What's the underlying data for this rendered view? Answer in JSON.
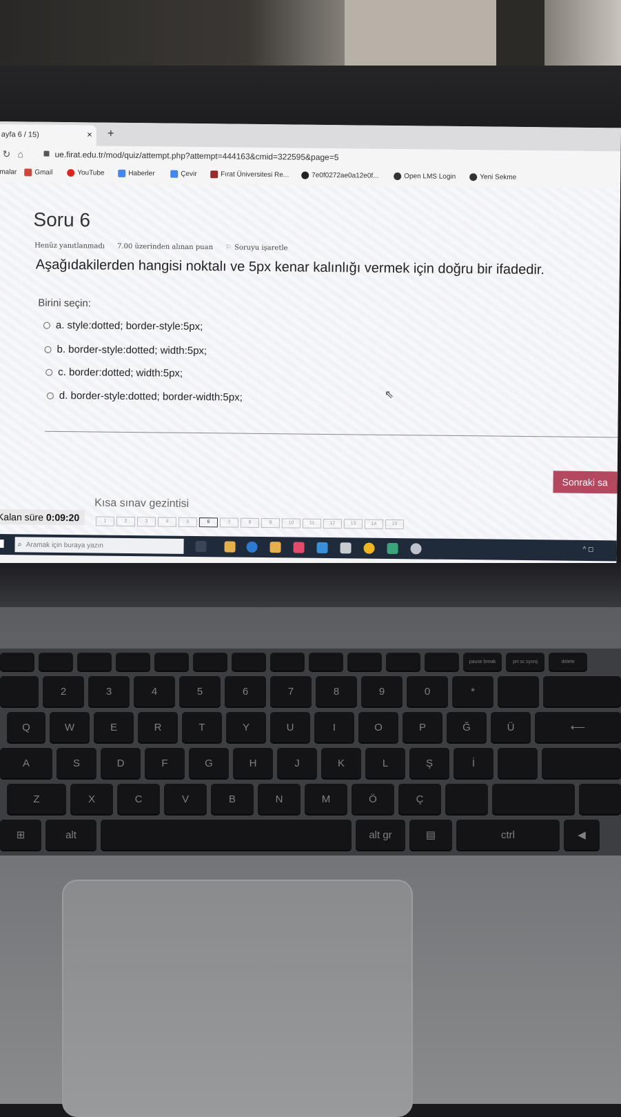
{
  "browser": {
    "tab_title": "ayfa 6 / 15)",
    "tab_close": "×",
    "new_tab": "+",
    "url": "ue.firat.edu.tr/mod/quiz/attempt.php?attempt=444163&cmid=322595&page=5",
    "bookmarks": [
      {
        "label": "malar",
        "icon_color": ""
      },
      {
        "label": "Gmail",
        "icon_color": "#d44638"
      },
      {
        "label": "YouTube",
        "icon_color": "#e62117"
      },
      {
        "label": "Haberler",
        "icon_color": "#4285f4"
      },
      {
        "label": "Çevir",
        "icon_color": "#4285f4"
      },
      {
        "label": "Fırat Üniversitesi Re...",
        "icon_color": "#9c2a2a"
      },
      {
        "label": "7e0f0272ae0a12e0f...",
        "icon_color": "#222222"
      },
      {
        "label": "Open LMS Login",
        "icon_color": "#333333"
      },
      {
        "label": "Yeni Sekme",
        "icon_color": "#333333"
      }
    ]
  },
  "question": {
    "title": "Soru 6",
    "status": "Henüz yanıtlanmadı",
    "points": "7.00 üzerinden alınan puan",
    "flag_label": "Soruyu işaretle",
    "text": "Aşağıdakilerden hangisi noktalı ve 5px kenar kalınlığı vermek için doğru bir ifadedir.",
    "choose_label": "Birini seçin:",
    "options": [
      "a. style:dotted; border-style:5px;",
      "b. border-style:dotted; width:5px;",
      "c. border:dotted; width:5px;",
      "d. border-style:dotted; border-width:5px;"
    ]
  },
  "next_button": "Sonraki sa",
  "quiz_nav_title": "Kısa sınav gezintisi",
  "timer": {
    "label": "Kalan süre",
    "value": "0:09:20"
  },
  "question_numbers": [
    "1",
    "2",
    "3",
    "4",
    "5",
    "6",
    "7",
    "8",
    "9",
    "10",
    "11",
    "12",
    "13",
    "14",
    "15"
  ],
  "taskbar": {
    "search_placeholder": "Aramak için buraya yazın"
  },
  "keyboard": {
    "number_row": [
      "2",
      "3",
      "4",
      "5",
      "6",
      "7",
      "8",
      "9",
      "0",
      "*"
    ],
    "q_row": [
      "Q",
      "W",
      "E",
      "R",
      "T",
      "Y",
      "U",
      "I",
      "O",
      "P",
      "Ğ",
      "Ü"
    ],
    "a_row": [
      "A",
      "S",
      "D",
      "F",
      "G",
      "H",
      "J",
      "K",
      "L",
      "Ş",
      "İ"
    ],
    "z_row": [
      "Z",
      "X",
      "C",
      "V",
      "B",
      "N",
      "M",
      "Ö",
      "Ç"
    ],
    "bottom_row": [
      "alt",
      "alt gr",
      "ctrl"
    ],
    "f_keys": [
      "pause break",
      "prt sc sysrq",
      "delete"
    ]
  }
}
